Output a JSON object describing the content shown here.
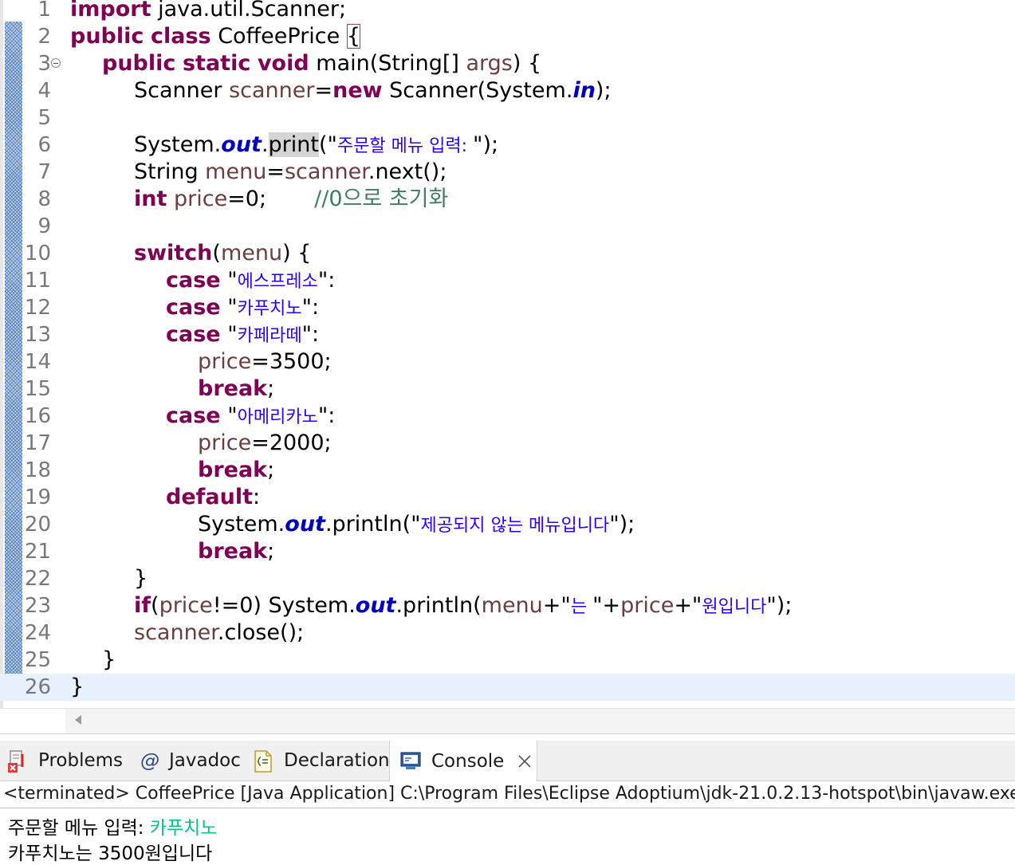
{
  "editor": {
    "lines": [
      {
        "n": "1",
        "indent": 0,
        "tokens": [
          {
            "t": "import",
            "c": "kw"
          },
          {
            "t": " java.util.Scanner;",
            "c": ""
          }
        ]
      },
      {
        "n": "2",
        "indent": 0,
        "tokens": [
          {
            "t": "public",
            "c": "kw"
          },
          {
            "t": " ",
            "c": ""
          },
          {
            "t": "class",
            "c": "kw"
          },
          {
            "t": " CoffeePrice ",
            "c": ""
          },
          {
            "t": "{",
            "c": "brace-box"
          }
        ]
      },
      {
        "n": "3",
        "indent": 1,
        "fold": true,
        "tokens": [
          {
            "t": "public",
            "c": "kw"
          },
          {
            "t": " ",
            "c": ""
          },
          {
            "t": "static",
            "c": "kw"
          },
          {
            "t": " ",
            "c": ""
          },
          {
            "t": "void",
            "c": "kw"
          },
          {
            "t": " main(String[] ",
            "c": ""
          },
          {
            "t": "args",
            "c": "var"
          },
          {
            "t": ") {",
            "c": ""
          }
        ]
      },
      {
        "n": "4",
        "indent": 2,
        "tokens": [
          {
            "t": "Scanner ",
            "c": ""
          },
          {
            "t": "scanner",
            "c": "var"
          },
          {
            "t": "=",
            "c": ""
          },
          {
            "t": "new",
            "c": "kw"
          },
          {
            "t": " Scanner(System.",
            "c": ""
          },
          {
            "t": "in",
            "c": "fld"
          },
          {
            "t": ");",
            "c": ""
          }
        ]
      },
      {
        "n": "5",
        "indent": 0,
        "tokens": []
      },
      {
        "n": "6",
        "indent": 2,
        "tokens": [
          {
            "t": "System.",
            "c": ""
          },
          {
            "t": "out",
            "c": "fld"
          },
          {
            "t": ".",
            "c": ""
          },
          {
            "t": "print",
            "c": "hl"
          },
          {
            "t": "(\"",
            "c": ""
          },
          {
            "t": "주문할 메뉴 입력: ",
            "c": "str"
          },
          {
            "t": "\");",
            "c": ""
          }
        ]
      },
      {
        "n": "7",
        "indent": 2,
        "tokens": [
          {
            "t": "String ",
            "c": ""
          },
          {
            "t": "menu",
            "c": "var"
          },
          {
            "t": "=",
            "c": ""
          },
          {
            "t": "scanner",
            "c": "var"
          },
          {
            "t": ".next();",
            "c": ""
          }
        ]
      },
      {
        "n": "8",
        "indent": 2,
        "tokens": [
          {
            "t": "int",
            "c": "kw"
          },
          {
            "t": " ",
            "c": ""
          },
          {
            "t": "price",
            "c": "var"
          },
          {
            "t": "=0;       ",
            "c": ""
          },
          {
            "t": "//0",
            "c": "cmt"
          },
          {
            "t": "으로 초기화",
            "c": "cmt"
          }
        ]
      },
      {
        "n": "9",
        "indent": 0,
        "tokens": []
      },
      {
        "n": "10",
        "indent": 2,
        "tokens": [
          {
            "t": "switch",
            "c": "kw"
          },
          {
            "t": "(",
            "c": ""
          },
          {
            "t": "menu",
            "c": "var"
          },
          {
            "t": ") {",
            "c": ""
          }
        ]
      },
      {
        "n": "11",
        "indent": 3,
        "tokens": [
          {
            "t": "case",
            "c": "kw"
          },
          {
            "t": " \"",
            "c": ""
          },
          {
            "t": "에스프레소",
            "c": "str"
          },
          {
            "t": "\":",
            "c": ""
          }
        ]
      },
      {
        "n": "12",
        "indent": 3,
        "tokens": [
          {
            "t": "case",
            "c": "kw"
          },
          {
            "t": " \"",
            "c": ""
          },
          {
            "t": "카푸치노",
            "c": "str"
          },
          {
            "t": "\":",
            "c": ""
          }
        ]
      },
      {
        "n": "13",
        "indent": 3,
        "tokens": [
          {
            "t": "case",
            "c": "kw"
          },
          {
            "t": " \"",
            "c": ""
          },
          {
            "t": "카페라떼",
            "c": "str"
          },
          {
            "t": "\":",
            "c": ""
          }
        ]
      },
      {
        "n": "14",
        "indent": 4,
        "tokens": [
          {
            "t": "price",
            "c": "var"
          },
          {
            "t": "=3500;",
            "c": ""
          }
        ]
      },
      {
        "n": "15",
        "indent": 4,
        "tokens": [
          {
            "t": "break",
            "c": "kw"
          },
          {
            "t": ";",
            "c": ""
          }
        ]
      },
      {
        "n": "16",
        "indent": 3,
        "tokens": [
          {
            "t": "case",
            "c": "kw"
          },
          {
            "t": " \"",
            "c": ""
          },
          {
            "t": "아메리카노",
            "c": "str"
          },
          {
            "t": "\":",
            "c": ""
          }
        ]
      },
      {
        "n": "17",
        "indent": 4,
        "tokens": [
          {
            "t": "price",
            "c": "var"
          },
          {
            "t": "=2000;",
            "c": ""
          }
        ]
      },
      {
        "n": "18",
        "indent": 4,
        "tokens": [
          {
            "t": "break",
            "c": "kw"
          },
          {
            "t": ";",
            "c": ""
          }
        ]
      },
      {
        "n": "19",
        "indent": 3,
        "tokens": [
          {
            "t": "default",
            "c": "kw"
          },
          {
            "t": ":",
            "c": ""
          }
        ]
      },
      {
        "n": "20",
        "indent": 4,
        "tokens": [
          {
            "t": "System.",
            "c": ""
          },
          {
            "t": "out",
            "c": "fld"
          },
          {
            "t": ".println(\"",
            "c": ""
          },
          {
            "t": "제공되지 않는 메뉴입니다",
            "c": "str"
          },
          {
            "t": "\");",
            "c": ""
          }
        ]
      },
      {
        "n": "21",
        "indent": 4,
        "tokens": [
          {
            "t": "break",
            "c": "kw"
          },
          {
            "t": ";",
            "c": ""
          }
        ]
      },
      {
        "n": "22",
        "indent": 2,
        "tokens": [
          {
            "t": "}",
            "c": ""
          }
        ]
      },
      {
        "n": "23",
        "indent": 2,
        "tokens": [
          {
            "t": "if",
            "c": "kw"
          },
          {
            "t": "(",
            "c": ""
          },
          {
            "t": "price",
            "c": "var"
          },
          {
            "t": "!=0) System.",
            "c": ""
          },
          {
            "t": "out",
            "c": "fld"
          },
          {
            "t": ".println(",
            "c": ""
          },
          {
            "t": "menu",
            "c": "var"
          },
          {
            "t": "+\"",
            "c": ""
          },
          {
            "t": "는 ",
            "c": "str"
          },
          {
            "t": "\"+",
            "c": ""
          },
          {
            "t": "price",
            "c": "var"
          },
          {
            "t": "+\"",
            "c": ""
          },
          {
            "t": "원입니다",
            "c": "str"
          },
          {
            "t": "\");",
            "c": ""
          }
        ]
      },
      {
        "n": "24",
        "indent": 2,
        "tokens": [
          {
            "t": "scanner",
            "c": "var"
          },
          {
            "t": ".close();",
            "c": ""
          }
        ]
      },
      {
        "n": "25",
        "indent": 1,
        "tokens": [
          {
            "t": "}",
            "c": ""
          }
        ]
      },
      {
        "n": "26",
        "indent": 0,
        "current": true,
        "tokens": [
          {
            "t": "}",
            "c": ""
          }
        ]
      }
    ]
  },
  "views": {
    "tabs": [
      {
        "label": "Problems",
        "icon": "problems-icon"
      },
      {
        "label": "Javadoc",
        "icon": "javadoc-icon"
      },
      {
        "label": "Declaration",
        "icon": "declaration-icon"
      },
      {
        "label": "Console",
        "icon": "console-icon",
        "active": true
      }
    ],
    "console": {
      "header": "<terminated> CoffeePrice [Java Application] C:\\Program Files\\Eclipse Adoptium\\jdk-21.0.2.13-hotspot\\bin\\javaw.exe",
      "prompt": "주문할 메뉴 입력: ",
      "user_input": "카푸치노",
      "output": "카푸치노는 3500원입니다"
    }
  },
  "colors": {
    "keyword": "#7f0055",
    "variable": "#6a3e3e",
    "string": "#2a00ff",
    "comment": "#3f7f5f",
    "field": "#0000c0",
    "console_input": "#00c87d",
    "current_line": "#e8f2fe"
  }
}
